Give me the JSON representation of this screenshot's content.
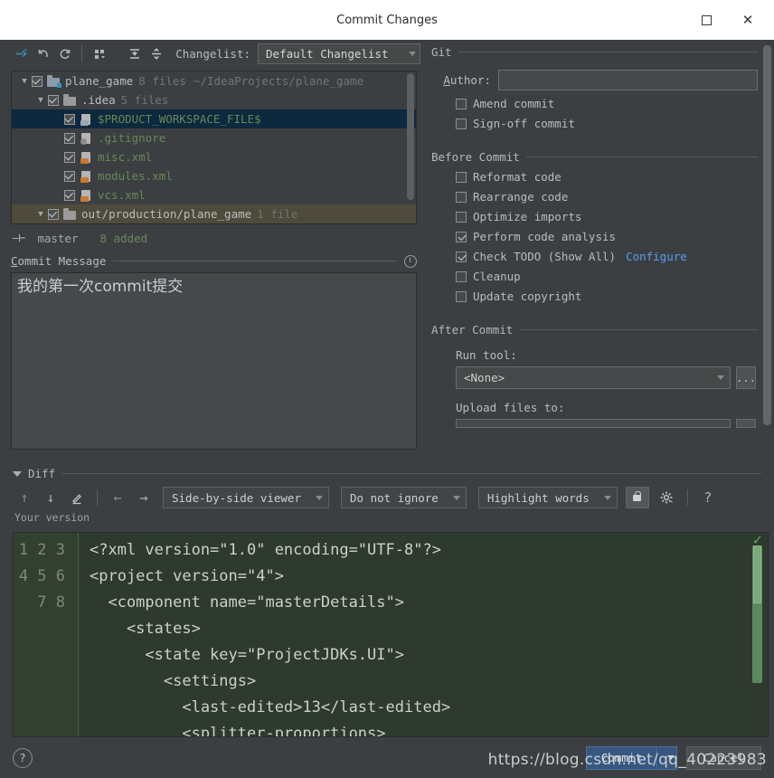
{
  "window": {
    "title": "Commit Changes",
    "maximize_label": "maximize",
    "close_label": "✕"
  },
  "toolbar": {
    "icons": [
      {
        "name": "show-diff-icon",
        "glyph": "⇥"
      },
      {
        "name": "revert-icon",
        "glyph": "↺"
      },
      {
        "name": "refresh-icon",
        "glyph": "↻"
      },
      {
        "name": "group-by-icon",
        "glyph": "∷"
      },
      {
        "name": "expand-all-icon",
        "glyph": "⤓"
      },
      {
        "name": "collapse-all-icon",
        "glyph": "⤑"
      }
    ],
    "changelist_label": "Changelist:",
    "changelist_value": "Default Changelist"
  },
  "file_tree": {
    "rows": [
      {
        "indent": 0,
        "caret": "▼",
        "checked": true,
        "icon": "folder-modified-icon",
        "name": "plane_game",
        "name_style": "plain",
        "count": "8 files",
        "path": "~/IdeaProjects/plane_game",
        "state": "normal"
      },
      {
        "indent": 1,
        "caret": "▼",
        "checked": true,
        "icon": "folder-icon",
        "name": ".idea",
        "name_style": "plain",
        "count": "5 files",
        "path": "",
        "state": "normal"
      },
      {
        "indent": 2,
        "caret": "",
        "checked": true,
        "icon": "workspace-file-icon",
        "name": "$PRODUCT_WORKSPACE_FILE$",
        "name_style": "green",
        "count": "",
        "path": "",
        "state": "selected"
      },
      {
        "indent": 2,
        "caret": "",
        "checked": true,
        "icon": "gitignore-file-icon",
        "name": ".gitignore",
        "name_style": "green",
        "count": "",
        "path": "",
        "state": "normal"
      },
      {
        "indent": 2,
        "caret": "",
        "checked": true,
        "icon": "xml-file-icon",
        "name": "misc.xml",
        "name_style": "green",
        "count": "",
        "path": "",
        "state": "normal"
      },
      {
        "indent": 2,
        "caret": "",
        "checked": true,
        "icon": "xml-file-icon",
        "name": "modules.xml",
        "name_style": "green",
        "count": "",
        "path": "",
        "state": "normal"
      },
      {
        "indent": 2,
        "caret": "",
        "checked": true,
        "icon": "xml-file-icon",
        "name": "vcs.xml",
        "name_style": "green",
        "count": "",
        "path": "",
        "state": "normal"
      },
      {
        "indent": 1,
        "caret": "▼",
        "checked": true,
        "icon": "folder-icon",
        "name": "out/production/plane_game",
        "name_style": "plain",
        "count": "1 file",
        "path": "",
        "state": "highlighted"
      }
    ]
  },
  "branch_status": {
    "branch": "master",
    "added": "8 added"
  },
  "commit_message": {
    "label": "Commit Message",
    "mnemonic_prefix": "C",
    "value": "我的第一次commit提交",
    "history_icon": "clock-icon"
  },
  "git_section": {
    "title": "Git",
    "author_label": "Author:",
    "author_value": "",
    "checkboxes": [
      {
        "label": "Amend commit",
        "checked": false,
        "name": "amend-commit-checkbox"
      },
      {
        "label": "Sign-off commit",
        "checked": false,
        "name": "sign-off-commit-checkbox"
      }
    ]
  },
  "before_commit": {
    "title": "Before Commit",
    "checkboxes": [
      {
        "label": "Reformat code",
        "checked": false,
        "name": "reformat-code-checkbox",
        "link": ""
      },
      {
        "label": "Rearrange code",
        "checked": false,
        "name": "rearrange-code-checkbox",
        "link": ""
      },
      {
        "label": "Optimize imports",
        "checked": false,
        "name": "optimize-imports-checkbox",
        "link": ""
      },
      {
        "label": "Perform code analysis",
        "checked": true,
        "name": "perform-code-analysis-checkbox",
        "link": ""
      },
      {
        "label": "Check TODO (Show All)",
        "checked": true,
        "name": "check-todo-checkbox",
        "link": "Configure"
      },
      {
        "label": "Cleanup",
        "checked": false,
        "name": "cleanup-checkbox",
        "link": ""
      },
      {
        "label": "Update copyright",
        "checked": false,
        "name": "update-copyright-checkbox",
        "link": ""
      }
    ]
  },
  "after_commit": {
    "title": "After Commit",
    "run_tool_label": "Run tool:",
    "run_tool_value": "<None>",
    "browse_label": "...",
    "upload_files_label": "Upload files to:"
  },
  "diff": {
    "title": "Diff",
    "toolbar": {
      "prev_diff_icon": "↑",
      "next_diff_icon": "↓",
      "edit_icon": "✐",
      "apply_left_icon": "←",
      "apply_right_icon": "→",
      "viewer_mode": "Side-by-side viewer",
      "whitespace_mode": "Do not ignore",
      "highlight_mode": "Highlight words",
      "lock_icon": "lock-icon",
      "settings_icon": "gear-icon",
      "help_icon": "?"
    },
    "pane_label": "Your version",
    "line_numbers": [
      "1",
      "2",
      "3",
      "4",
      "5",
      "6",
      "7",
      "8"
    ],
    "lines": [
      "<?xml version=\"1.0\" encoding=\"UTF-8\"?>",
      "<project version=\"4\">",
      "  <component name=\"masterDetails\">",
      "    <states>",
      "      <state key=\"ProjectJDKs.UI\">",
      "        <settings>",
      "          <last-edited>13</last-edited>",
      "          <splitter-proportions>"
    ],
    "status_check": "✓"
  },
  "footer": {
    "help_label": "?",
    "commit_label": "Commit",
    "commit_dropdown_glyph": "▼",
    "cancel_label": "Cancel"
  },
  "watermark": "https://blog.csdn.net/qq_40223983",
  "colors": {
    "accent_blue": "#365880",
    "link_blue": "#589df6",
    "file_green": "#6a8759",
    "diff_background": "#2f3a2f",
    "selection_blue": "#0d293e",
    "window_background": "#3c3f41"
  }
}
